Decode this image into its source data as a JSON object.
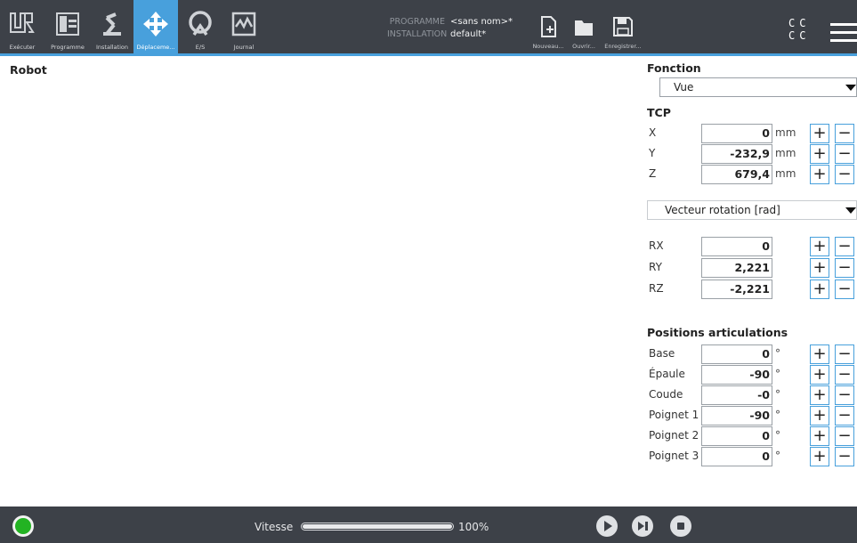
{
  "header": {
    "tabs": [
      {
        "label": "Exécuter",
        "icon": "ur-logo-icon"
      },
      {
        "label": "Programme",
        "icon": "program-icon"
      },
      {
        "label": "Installation",
        "icon": "installation-icon"
      },
      {
        "label": "Déplaceme...",
        "icon": "move-icon",
        "active": true
      },
      {
        "label": "E/S",
        "icon": "io-icon"
      },
      {
        "label": "Journal",
        "icon": "log-icon"
      }
    ],
    "programme_key": "PROGRAMME",
    "programme_value": "<sans nom>*",
    "installation_key": "INSTALLATION",
    "installation_value": "default*",
    "file_buttons": [
      {
        "label": "Nouveau...",
        "icon": "new-file-icon"
      },
      {
        "label": "Ouvrir...",
        "icon": "folder-icon"
      },
      {
        "label": "Enregistrer...",
        "icon": "save-icon"
      }
    ],
    "status_letters": [
      "C",
      "C",
      "C",
      "C"
    ],
    "accent": "#48a0dc",
    "bar_color": "#3d4148"
  },
  "main": {
    "robot_title": "Robot"
  },
  "panel": {
    "fonction_title": "Fonction",
    "fonction_value": "Vue",
    "tcp_title": "TCP",
    "tcp": [
      {
        "label": "X",
        "value": "0",
        "unit": "mm"
      },
      {
        "label": "Y",
        "value": "-232,9",
        "unit": "mm"
      },
      {
        "label": "Z",
        "value": "679,4",
        "unit": "mm"
      }
    ],
    "rotation_mode": "Vecteur rotation [rad]",
    "rotation": [
      {
        "label": "RX",
        "value": "0"
      },
      {
        "label": "RY",
        "value": "2,221"
      },
      {
        "label": "RZ",
        "value": "-2,221"
      }
    ],
    "joints_title": "Positions articulations",
    "joints": [
      {
        "label": "Base",
        "value": "0",
        "unit": "°"
      },
      {
        "label": "Épaule",
        "value": "-90",
        "unit": "°"
      },
      {
        "label": "Coude",
        "value": "-0",
        "unit": "°"
      },
      {
        "label": "Poignet 1",
        "value": "-90",
        "unit": "°"
      },
      {
        "label": "Poignet 2",
        "value": "0",
        "unit": "°"
      },
      {
        "label": "Poignet 3",
        "value": "0",
        "unit": "°"
      }
    ],
    "plus": "+",
    "minus": "−"
  },
  "footer": {
    "speed_label": "Vitesse",
    "speed_value": "100%",
    "speed_fraction": 1.0,
    "power_status_color": "#23b323",
    "controls": [
      "play-icon",
      "step-icon",
      "stop-icon"
    ]
  }
}
